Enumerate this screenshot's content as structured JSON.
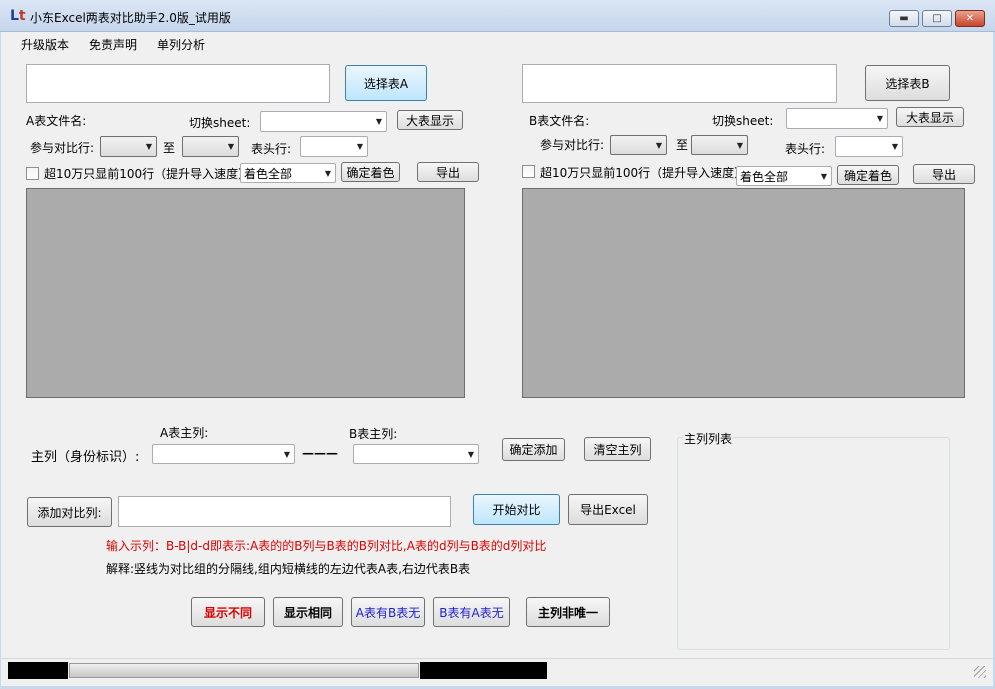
{
  "window": {
    "title": "小东Excel两表对比助手2.0版_试用版",
    "icon_text_a": "L",
    "icon_text_b": "t",
    "minimize": "▬",
    "maximize": "□",
    "close": "✕"
  },
  "menu": {
    "items": [
      "升级版本",
      "免责声明",
      "单列分析"
    ]
  },
  "panelA": {
    "select_button": "选择表A",
    "file_label": "A表文件名:",
    "sheet_label": "切换sheet:",
    "big_view_button": "大表显示",
    "compare_rows_label": "参与对比行:",
    "to_label": "至",
    "header_row_label": "表头行:",
    "checkbox_label": "超10万只显前100行（提升导入速度）",
    "color_select": "着色全部",
    "confirm_color_button": "确定着色",
    "export_button": "导出"
  },
  "panelB": {
    "select_button": "选择表B",
    "file_label": "B表文件名:",
    "sheet_label": "切换sheet:",
    "big_view_button": "大表显示",
    "compare_rows_label": "参与对比行:",
    "to_label": "至",
    "header_row_label": "表头行:",
    "checkbox_label": "超10万只显前100行（提升导入速度）",
    "color_select": "着色全部",
    "confirm_color_button": "确定着色",
    "export_button": "导出"
  },
  "keycol": {
    "a_label": "A表主列:",
    "b_label": "B表主列:",
    "main_label": "主列（身份标识）:",
    "dash": "———",
    "confirm_add_button": "确定添加",
    "clear_button": "清空主列",
    "list_title": "主列列表"
  },
  "compare": {
    "add_column_button": "添加对比列:",
    "start_button": "开始对比",
    "export_excel_button": "导出Excel",
    "example_text": "输入示列：B-B|d-d即表示:A表的的B列与B表的B列对比,A表的d列与B表的d列对比",
    "explain_text": "解释:竖线为对比组的分隔线,组内短横线的左边代表A表,右边代表B表"
  },
  "result_buttons": {
    "show_diff": "显示不同",
    "show_same": "显示相同",
    "a_has_b_not": "A表有B表无",
    "b_has_a_not": "B表有A表无",
    "key_not_unique": "主列非唯一"
  },
  "colors": {
    "accent_red": "#dd0000",
    "accent_blue": "#1f1fd0"
  }
}
